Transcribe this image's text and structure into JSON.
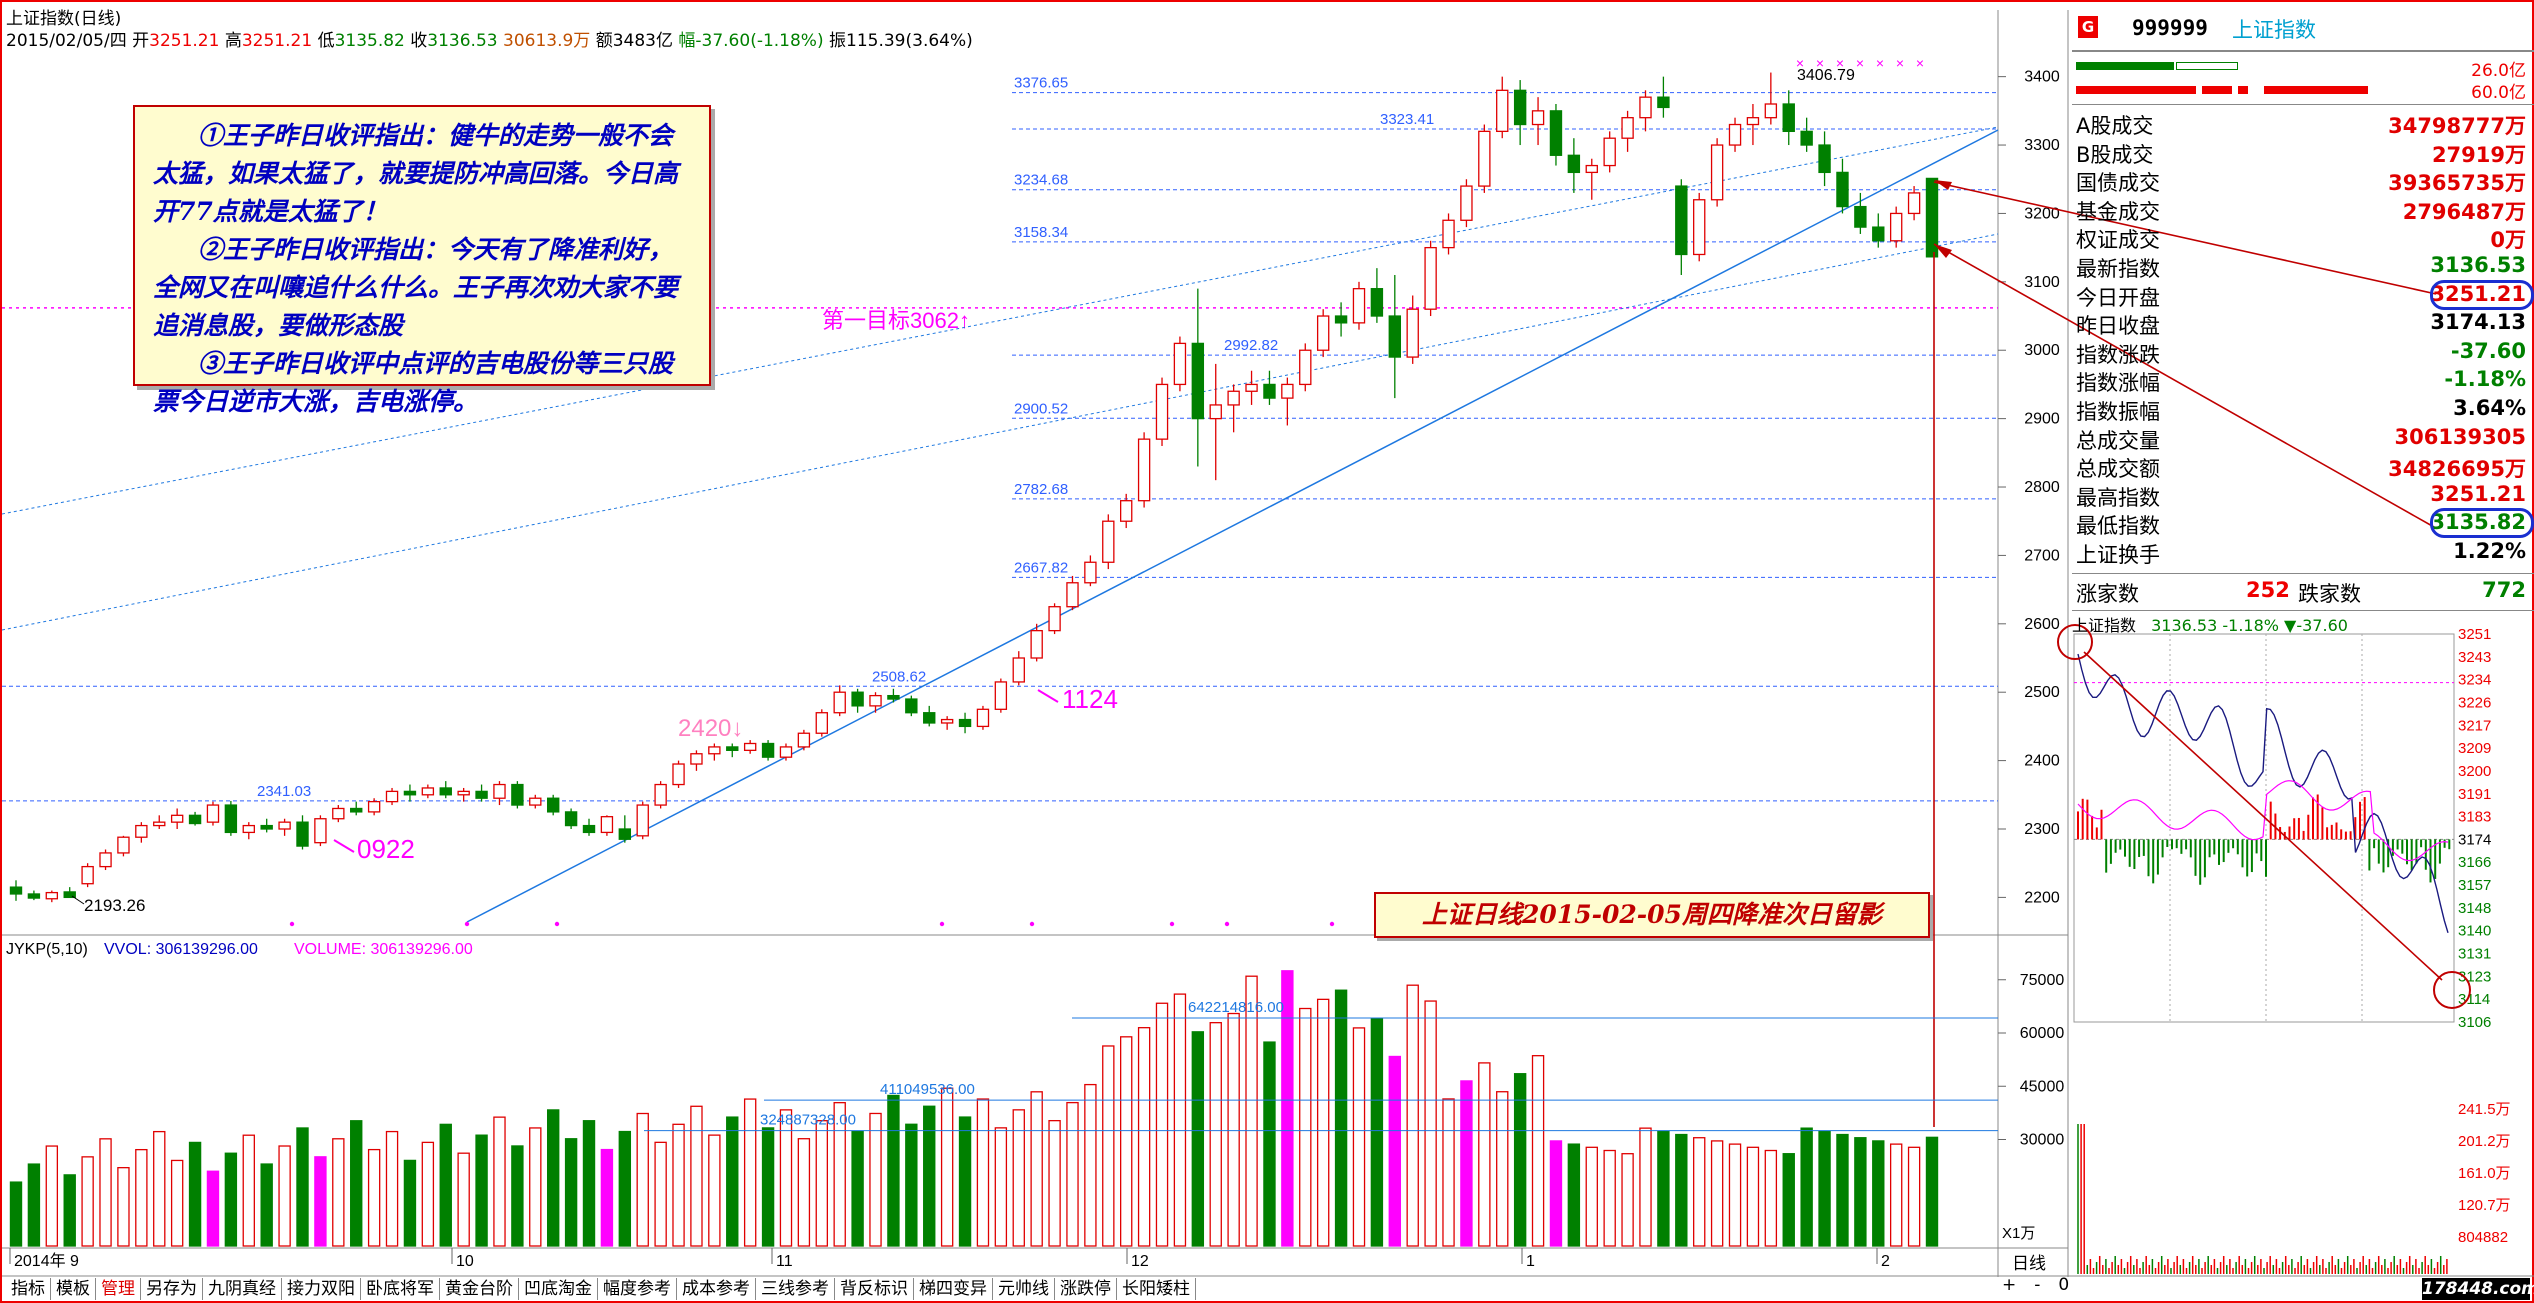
{
  "header": {
    "title": "上证指数(日线)",
    "date": "2015/02/05/四",
    "open_label": "开",
    "open": "3251.21",
    "high_label": "高",
    "high": "3251.21",
    "low_label": "低",
    "low": "3135.82",
    "close_label": "收",
    "close": "3136.53",
    "volume_text": "30613.9万",
    "amount_text": "额3483亿",
    "change_text": "幅-37.60(-1.18%)",
    "amplitude_text": "振115.39(3.64%)"
  },
  "annotation": {
    "p1": "①王子昨日收评指出：健牛的走势一般不会太猛，如果太猛了，就要提防冲高回落。今日高开77点就是太猛了！",
    "p2": "②王子昨日收评指出：今天有了降准利好，全网又在叫嚷追什么什么。王子再次劝大家不要追消息股，要做形态股",
    "p3": "③王子昨日收评中点评的吉电股份等三只股票今日逆市大涨，吉电涨停。"
  },
  "caption": "上证日线2015-02-05周四降准次日留影",
  "chart_labels": {
    "target": "第一目标3062↑",
    "mark_2420": "2420↓",
    "mark_1124": "1124",
    "mark_0922": "0922",
    "low_2193": "2193.26",
    "high_3406": "3406.79"
  },
  "colors": {
    "up": "#e00000",
    "down": "#008000",
    "highlight": "#ff00ff",
    "trend": "#1e78e0",
    "fib": "#3060ff"
  },
  "chart_data": [
    {
      "type": "candlestick",
      "title": "上证指数(日线)",
      "ylim": [
        2150,
        3420
      ],
      "y_ticks": [
        2200,
        2300,
        2400,
        2500,
        2600,
        2700,
        2800,
        2900,
        3000,
        3100,
        3200,
        3300,
        3400
      ],
      "x_ticks": [
        "2014年 9",
        "10",
        "11",
        "12",
        "1",
        "2"
      ],
      "levels": [
        3376.65,
        3323.41,
        3234.68,
        3158.34,
        2992.82,
        2900.52,
        2782.68,
        2667.82,
        2508.62,
        2341.03
      ],
      "level_labels": [
        "3376.65",
        "3323.41",
        "3234.68",
        "3158.34",
        "2992.82",
        "2900.52",
        "2782.68",
        "2667.82",
        "2508.62",
        "2341.03"
      ],
      "candles": [
        [
          2215,
          2225,
          2195,
          2205
        ],
        [
          2205,
          2210,
          2196,
          2199
        ],
        [
          2198,
          2210,
          2193,
          2207
        ],
        [
          2208,
          2215,
          2200,
          2200
        ],
        [
          2220,
          2250,
          2215,
          2245
        ],
        [
          2245,
          2270,
          2240,
          2265
        ],
        [
          2265,
          2290,
          2260,
          2288
        ],
        [
          2288,
          2310,
          2280,
          2305
        ],
        [
          2305,
          2320,
          2300,
          2310
        ],
        [
          2310,
          2330,
          2300,
          2320
        ],
        [
          2320,
          2325,
          2305,
          2308
        ],
        [
          2310,
          2340,
          2305,
          2335
        ],
        [
          2335,
          2341,
          2290,
          2295
        ],
        [
          2295,
          2310,
          2285,
          2305
        ],
        [
          2305,
          2315,
          2295,
          2300
        ],
        [
          2300,
          2315,
          2290,
          2310
        ],
        [
          2310,
          2320,
          2270,
          2275
        ],
        [
          2280,
          2320,
          2275,
          2315
        ],
        [
          2315,
          2335,
          2310,
          2330
        ],
        [
          2330,
          2340,
          2320,
          2325
        ],
        [
          2325,
          2345,
          2320,
          2340
        ],
        [
          2340,
          2360,
          2335,
          2355
        ],
        [
          2355,
          2365,
          2340,
          2350
        ],
        [
          2350,
          2365,
          2345,
          2360
        ],
        [
          2360,
          2370,
          2345,
          2350
        ],
        [
          2350,
          2360,
          2340,
          2355
        ],
        [
          2355,
          2365,
          2340,
          2345
        ],
        [
          2345,
          2370,
          2335,
          2365
        ],
        [
          2365,
          2370,
          2330,
          2335
        ],
        [
          2335,
          2350,
          2330,
          2345
        ],
        [
          2345,
          2350,
          2320,
          2325
        ],
        [
          2325,
          2330,
          2300,
          2305
        ],
        [
          2305,
          2315,
          2290,
          2295
        ],
        [
          2295,
          2320,
          2290,
          2318
        ],
        [
          2300,
          2320,
          2280,
          2285
        ],
        [
          2290,
          2340,
          2285,
          2335
        ],
        [
          2335,
          2370,
          2330,
          2365
        ],
        [
          2365,
          2400,
          2360,
          2395
        ],
        [
          2395,
          2415,
          2385,
          2410
        ],
        [
          2410,
          2425,
          2400,
          2420
        ],
        [
          2420,
          2425,
          2405,
          2415
        ],
        [
          2415,
          2430,
          2410,
          2425
        ],
        [
          2425,
          2430,
          2400,
          2405
        ],
        [
          2405,
          2425,
          2400,
          2420
        ],
        [
          2420,
          2445,
          2415,
          2440
        ],
        [
          2440,
          2475,
          2435,
          2470
        ],
        [
          2470,
          2510,
          2465,
          2500
        ],
        [
          2500,
          2505,
          2470,
          2480
        ],
        [
          2480,
          2500,
          2470,
          2495
        ],
        [
          2495,
          2505,
          2485,
          2490
        ],
        [
          2490,
          2495,
          2465,
          2470
        ],
        [
          2470,
          2480,
          2450,
          2455
        ],
        [
          2455,
          2465,
          2445,
          2460
        ],
        [
          2460,
          2470,
          2440,
          2450
        ],
        [
          2450,
          2480,
          2445,
          2475
        ],
        [
          2475,
          2520,
          2470,
          2515
        ],
        [
          2515,
          2560,
          2510,
          2550
        ],
        [
          2550,
          2600,
          2545,
          2590
        ],
        [
          2590,
          2630,
          2585,
          2625
        ],
        [
          2625,
          2670,
          2620,
          2660
        ],
        [
          2660,
          2700,
          2655,
          2690
        ],
        [
          2690,
          2760,
          2680,
          2750
        ],
        [
          2750,
          2790,
          2740,
          2780
        ],
        [
          2780,
          2880,
          2770,
          2870
        ],
        [
          2870,
          2960,
          2860,
          2950
        ],
        [
          2950,
          3020,
          2940,
          3010
        ],
        [
          3010,
          3090,
          2830,
          2900
        ],
        [
          2900,
          2980,
          2810,
          2920
        ],
        [
          2920,
          2950,
          2880,
          2940
        ],
        [
          2940,
          2970,
          2920,
          2950
        ],
        [
          2950,
          2970,
          2920,
          2930
        ],
        [
          2930,
          2960,
          2890,
          2950
        ],
        [
          2950,
          3010,
          2940,
          3000
        ],
        [
          3000,
          3060,
          2990,
          3050
        ],
        [
          3050,
          3070,
          3020,
          3040
        ],
        [
          3040,
          3100,
          3030,
          3090
        ],
        [
          3090,
          3120,
          3040,
          3050
        ],
        [
          3050,
          3110,
          2930,
          2990
        ],
        [
          2990,
          3080,
          2980,
          3060
        ],
        [
          3060,
          3160,
          3050,
          3150
        ],
        [
          3150,
          3200,
          3140,
          3190
        ],
        [
          3190,
          3250,
          3180,
          3240
        ],
        [
          3240,
          3330,
          3230,
          3320
        ],
        [
          3320,
          3400,
          3310,
          3380
        ],
        [
          3380,
          3395,
          3300,
          3330
        ],
        [
          3330,
          3370,
          3300,
          3350
        ],
        [
          3350,
          3360,
          3270,
          3285
        ],
        [
          3285,
          3310,
          3230,
          3260
        ],
        [
          3260,
          3280,
          3220,
          3270
        ],
        [
          3270,
          3320,
          3260,
          3310
        ],
        [
          3310,
          3350,
          3290,
          3340
        ],
        [
          3340,
          3380,
          3320,
          3370
        ],
        [
          3370,
          3400,
          3340,
          3355
        ],
        [
          3240,
          3250,
          3110,
          3140
        ],
        [
          3140,
          3230,
          3130,
          3220
        ],
        [
          3220,
          3310,
          3210,
          3300
        ],
        [
          3300,
          3340,
          3290,
          3330
        ],
        [
          3330,
          3360,
          3300,
          3340
        ],
        [
          3340,
          3406,
          3330,
          3360
        ],
        [
          3360,
          3380,
          3300,
          3320
        ],
        [
          3320,
          3340,
          3290,
          3300
        ],
        [
          3300,
          3320,
          3240,
          3260
        ],
        [
          3260,
          3280,
          3200,
          3210
        ],
        [
          3210,
          3230,
          3170,
          3180
        ],
        [
          3180,
          3200,
          3150,
          3160
        ],
        [
          3160,
          3210,
          3150,
          3200
        ],
        [
          3200,
          3240,
          3190,
          3230
        ],
        [
          3251.21,
          3251.21,
          3135.82,
          3136.53
        ]
      ]
    },
    {
      "type": "bar",
      "title": "VOLUME",
      "series_label_1": "JYKP(5,10)",
      "series_label_2": "VVOL: 306139296.00",
      "series_label_3": "VOLUME: 306139296.00",
      "y_ticks": [
        30000,
        45000,
        60000,
        75000
      ],
      "unit": "X1万",
      "volume_marks": [
        "642214816.00",
        "411049536.00",
        "324887328.00"
      ]
    },
    {
      "type": "line",
      "title": "上证指数",
      "price_text": "3136.53 -1.18% ▼-37.60",
      "y_ticks": [
        "3251",
        "3243",
        "3234",
        "3226",
        "3217",
        "3209",
        "3200",
        "3191",
        "3183",
        "3174",
        "3166",
        "3157",
        "3148",
        "3140",
        "3131",
        "3123",
        "3114",
        "3106"
      ],
      "vol_ticks": [
        "241.5万",
        "201.2万",
        "161.0万",
        "120.7万",
        "804882"
      ]
    }
  ],
  "right_panel": {
    "code": "999999",
    "name": "上证指数",
    "g_label": "G",
    "bar_top_right": "26.0亿",
    "bar_bottom_right": "60.0亿",
    "rows": [
      {
        "label": "A股成交",
        "value": "34798777万",
        "color": "#e00000"
      },
      {
        "label": "B股成交",
        "value": "27919万",
        "color": "#e00000"
      },
      {
        "label": "国债成交",
        "value": "39365735万",
        "color": "#e00000"
      },
      {
        "label": "基金成交",
        "value": "2796487万",
        "color": "#e00000"
      },
      {
        "label": "权证成交",
        "value": "0万",
        "color": "#e00000"
      },
      {
        "label": "最新指数",
        "value": "3136.53",
        "color": "#008000"
      },
      {
        "label": "今日开盘",
        "value": "3251.21",
        "color": "#e00000"
      },
      {
        "label": "昨日收盘",
        "value": "3174.13",
        "color": "#000000"
      },
      {
        "label": "指数涨跌",
        "value": "-37.60",
        "color": "#008000"
      },
      {
        "label": "指数涨幅",
        "value": "-1.18%",
        "color": "#008000"
      },
      {
        "label": "指数振幅",
        "value": "3.64%",
        "color": "#000000"
      },
      {
        "label": "总成交量",
        "value": "306139305",
        "color": "#e00000"
      },
      {
        "label": "总成交额",
        "value": "34826695万",
        "color": "#e00000"
      },
      {
        "label": "最高指数",
        "value": "3251.21",
        "color": "#e00000"
      },
      {
        "label": "最低指数",
        "value": "3135.82",
        "color": "#008000"
      },
      {
        "label": "上证换手",
        "value": "1.22%",
        "color": "#000000"
      }
    ],
    "up_label": "涨家数",
    "up_count": "252",
    "down_label": "跌家数",
    "down_count": "772",
    "period_label": "日线"
  },
  "tabs": [
    "指标",
    "模板",
    "管理",
    "另存为",
    "九阴真经",
    "接力双阳",
    "卧底将军",
    "黄金台阶",
    "凹底淘金",
    "幅度参考",
    "成本参考",
    "三线参考",
    "背反标识",
    "梯四变异",
    "元帅线",
    "涨跌停",
    "长阳矮柱"
  ],
  "watermark": "178448.com"
}
